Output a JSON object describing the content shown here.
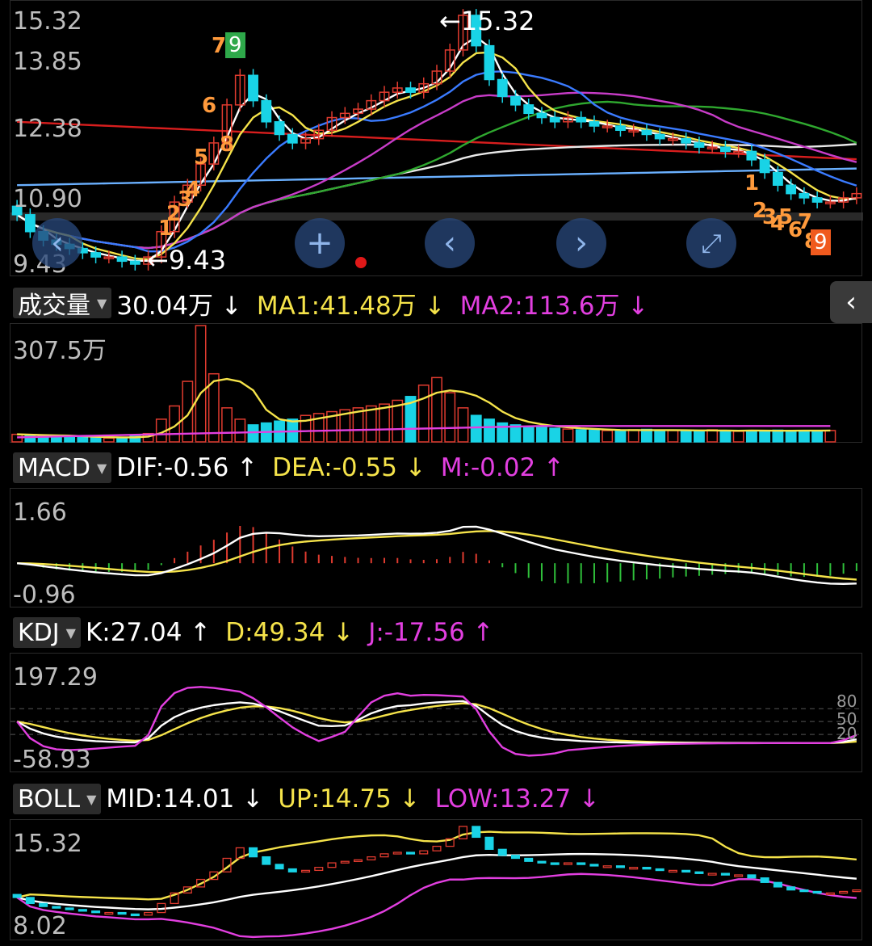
{
  "colors": {
    "up": "#e03b2f",
    "down": "#19d3e6",
    "ma5": "#ffffff",
    "ma10": "#f5e34a",
    "ma20": "#3a7bff",
    "ma30": "#c83cc8",
    "ma60": "#2fa82f",
    "ma120": "#e8e8e8",
    "ma250": "#6ab0ff",
    "ma_long": "#d81e1e",
    "yellow": "#f5e34a",
    "magenta": "#e23fe0",
    "grey": "#bdbdbd"
  },
  "price": {
    "tick_top": "15.32",
    "tick_2": "13.85",
    "tick_3": "12.38",
    "tick_4": "10.90",
    "tick_bottom": "9.43",
    "max_label": "←15.32",
    "min_label": "←9.43",
    "markers_up": [
      "1",
      "2",
      "3",
      "4",
      "5",
      "6",
      "7"
    ],
    "marker_up_9": "9",
    "markers_down": [
      "1",
      "2",
      "3",
      "4",
      "5",
      "6",
      "7",
      "8"
    ],
    "marker_down_9": "9"
  },
  "controls": {
    "zoom_in": "+",
    "prev": "‹",
    "next": "›",
    "expand": "⤢",
    "collapse": "‹"
  },
  "volume": {
    "selector": "成交量",
    "value": "30.04万 ↓",
    "ma1": "MA1:41.48万 ↓",
    "ma2": "MA2:113.6万 ↓",
    "tick_top": "307.5万"
  },
  "macd": {
    "selector": "MACD",
    "dif": "DIF:-0.56 ↑",
    "dea": "DEA:-0.55 ↓",
    "m": "M:-0.02 ↑",
    "tick_top": "1.66",
    "tick_bottom": "-0.96"
  },
  "kdj": {
    "selector": "KDJ",
    "k": "K:27.04 ↑",
    "d": "D:49.34 ↓",
    "j": "J:-17.56 ↑",
    "tick_top": "197.29",
    "tick_bottom": "-58.93",
    "ref_80": "80",
    "ref_50": "50",
    "ref_20": "20"
  },
  "boll": {
    "selector": "BOLL",
    "mid": "MID:14.01 ↓",
    "up": "UP:14.75 ↓",
    "low": "LOW:13.27 ↓",
    "tick_top": "15.32",
    "tick_bottom": "8.02"
  },
  "chart_data": [
    {
      "type": "line",
      "title": "",
      "price_axis": [
        9.43,
        15.32
      ],
      "ticks": [
        "15.32",
        "13.85",
        "12.38",
        "10.90",
        "9.43"
      ],
      "close": [
        10.6,
        10.2,
        10.0,
        9.9,
        9.8,
        9.7,
        9.6,
        9.6,
        9.5,
        9.43,
        9.6,
        10.2,
        10.9,
        11.3,
        11.8,
        12.3,
        13.2,
        13.9,
        13.3,
        12.8,
        12.5,
        12.3,
        12.4,
        12.6,
        12.9,
        13.0,
        13.1,
        13.3,
        13.5,
        13.6,
        13.5,
        13.7,
        14.0,
        14.5,
        15.32,
        14.6,
        13.8,
        13.4,
        13.2,
        13.0,
        12.9,
        12.8,
        12.9,
        12.8,
        12.7,
        12.7,
        12.6,
        12.6,
        12.5,
        12.4,
        12.4,
        12.3,
        12.2,
        12.2,
        12.1,
        12.1,
        11.9,
        11.6,
        11.3,
        11.1,
        11.0,
        10.9,
        10.9,
        11.0,
        11.1
      ]
    },
    {
      "type": "bar",
      "title": "",
      "series": [
        {
          "name": "成交量",
          "unit": "万"
        }
      ],
      "ylim": [
        0,
        307.5
      ],
      "values": [
        20,
        18,
        16,
        15,
        14,
        12,
        11,
        10,
        12,
        15,
        22,
        60,
        95,
        160,
        307.5,
        180,
        90,
        60,
        45,
        50,
        55,
        60,
        70,
        75,
        80,
        85,
        90,
        95,
        100,
        110,
        120,
        150,
        170,
        130,
        90,
        70,
        60,
        50,
        45,
        40,
        38,
        36,
        34,
        32,
        31,
        30,
        30,
        32,
        33,
        31,
        30,
        28,
        30,
        32,
        30,
        28,
        30,
        29,
        31,
        30,
        29,
        30,
        30.04
      ]
    },
    {
      "type": "bar",
      "title": "",
      "series": [
        {
          "name": "DIF"
        },
        {
          "name": "DEA"
        },
        {
          "name": "M"
        }
      ],
      "ylim": [
        -0.96,
        1.66
      ]
    },
    {
      "type": "line",
      "title": "",
      "series": [
        {
          "name": "K"
        },
        {
          "name": "D"
        },
        {
          "name": "J"
        }
      ],
      "ylim": [
        -58.93,
        197.29
      ]
    },
    {
      "type": "line",
      "title": "",
      "series": [
        {
          "name": "MID"
        },
        {
          "name": "UP"
        },
        {
          "name": "LOW"
        }
      ],
      "ylim": [
        8.02,
        15.32
      ]
    }
  ]
}
